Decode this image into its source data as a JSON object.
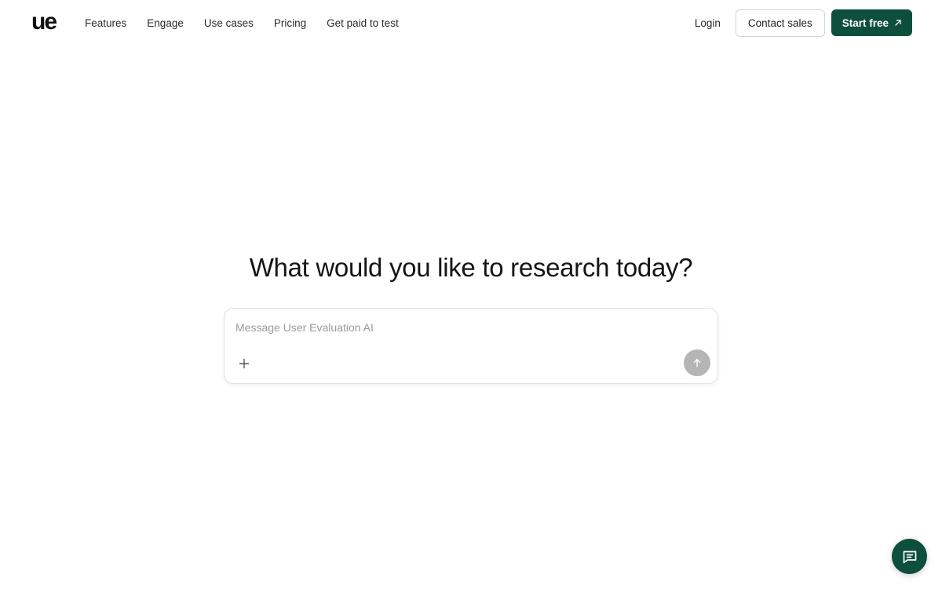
{
  "header": {
    "logo": "ue",
    "nav": [
      {
        "label": "Features"
      },
      {
        "label": "Engage"
      },
      {
        "label": "Use cases"
      },
      {
        "label": "Pricing"
      },
      {
        "label": "Get paid to test"
      }
    ],
    "login_label": "Login",
    "contact_label": "Contact sales",
    "start_label": "Start free",
    "start_icon": "arrow-up-right-icon"
  },
  "main": {
    "headline": "What would you like to research today?",
    "composer": {
      "placeholder": "Message User Evaluation AI",
      "value": "",
      "attach_icon": "plus-icon",
      "send_icon": "arrow-up-icon"
    }
  },
  "chat_widget": {
    "icon": "chat-bubble-icon"
  },
  "colors": {
    "brand": "#0d4f3c",
    "send_disabled": "#b5b5b5",
    "border": "#d4d4d4"
  }
}
